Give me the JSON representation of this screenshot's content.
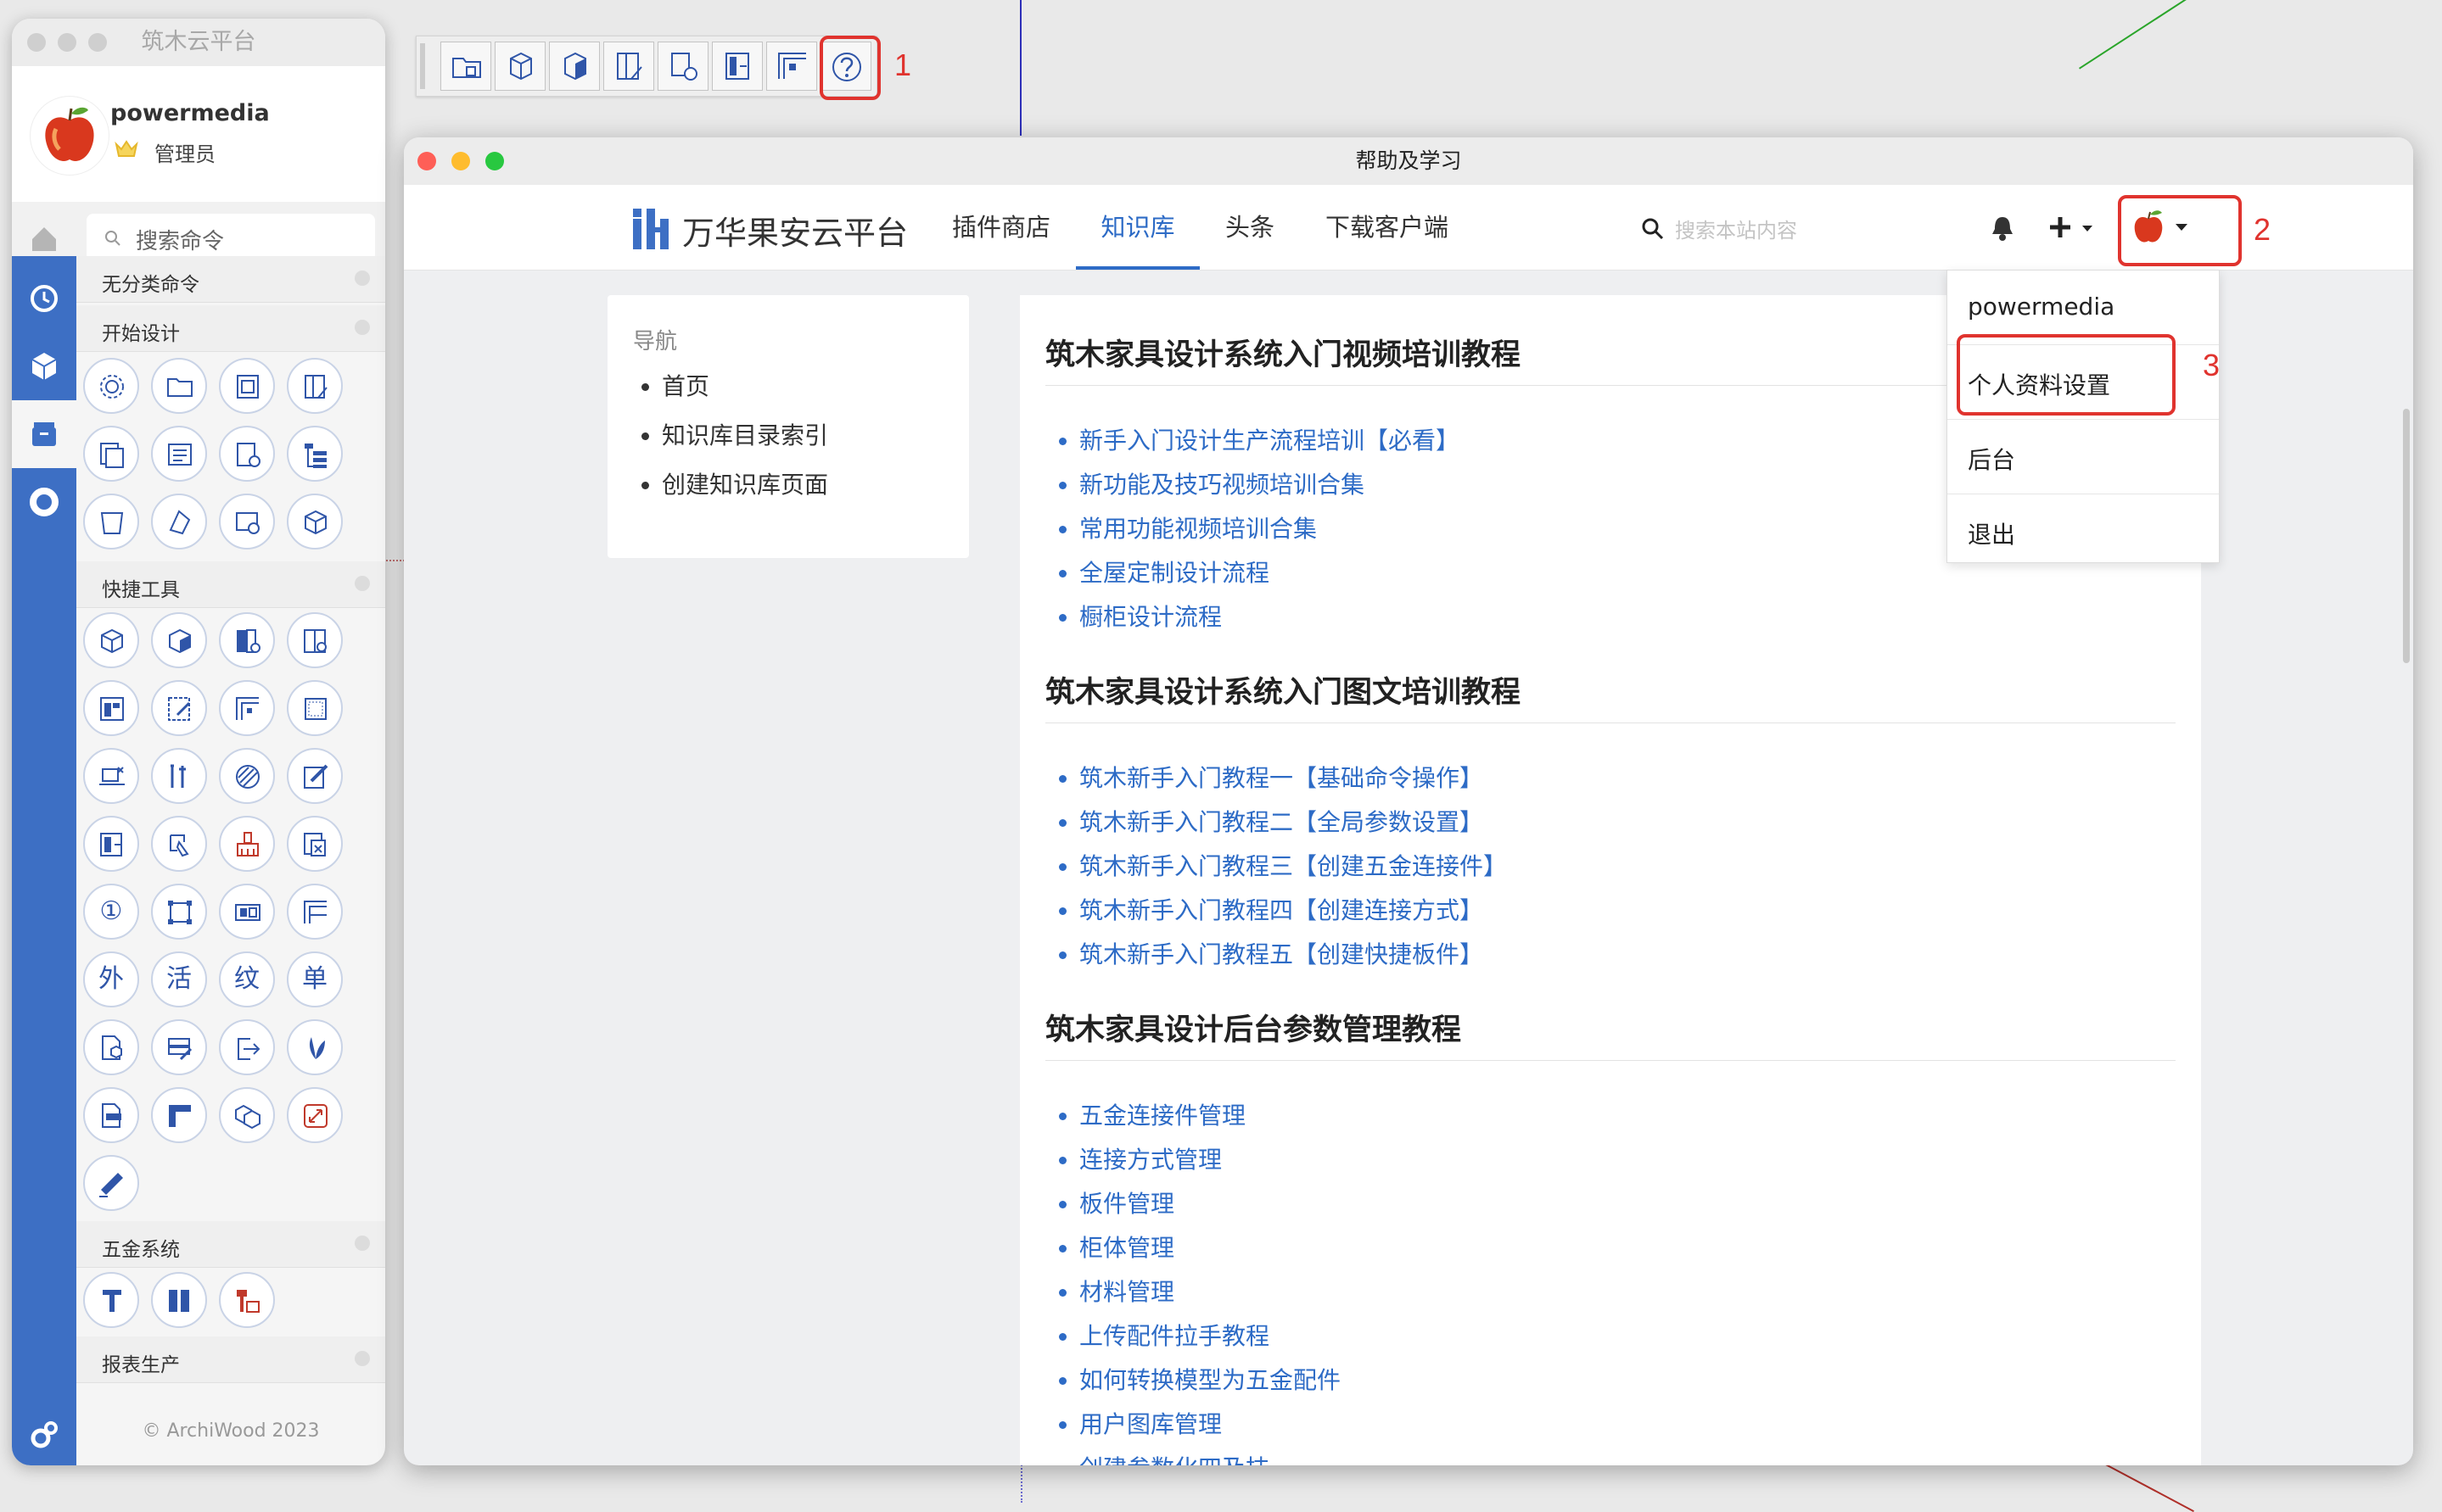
{
  "left_panel": {
    "title": "筑木云平台",
    "user_name": "powermedia",
    "user_role": "管理员",
    "search_placeholder": "搜索命令",
    "sections": [
      "无分类命令",
      "开始设计",
      "快捷工具",
      "五金系统",
      "报表生产"
    ],
    "text_tools": [
      "①",
      "外",
      "活",
      "纹",
      "单"
    ],
    "footer": "© ArchiWood 2023",
    "sidebar_icons": [
      "history-icon",
      "box-icon",
      "library-icon",
      "ring-icon",
      "settings-icon"
    ]
  },
  "toolbar": {
    "icons": [
      "folder-icon",
      "cube-icon",
      "cube-blue-icon",
      "panel-icon",
      "copy-icon",
      "door-icon",
      "corner-icon",
      "help-icon"
    ]
  },
  "annotations": [
    "1",
    "2",
    "3"
  ],
  "main_window": {
    "title": "帮助及学习",
    "brand": "万华果安云平台",
    "nav": [
      "插件商店",
      "知识库",
      "头条",
      "下载客户端"
    ],
    "active_nav": "知识库",
    "search_placeholder": "搜索本站内容",
    "sidebar_nav": {
      "heading": "导航",
      "items": [
        "首页",
        "知识库目录索引",
        "创建知识库页面"
      ]
    },
    "dropdown": [
      "powermedia",
      "个人资料设置",
      "后台",
      "退出"
    ],
    "sections": [
      {
        "title": "筑木家具设计系统入门视频培训教程",
        "links": [
          "新手入门设计生产流程培训【必看】",
          "新功能及技巧视频培训合集",
          "常用功能视频培训合集",
          "全屋定制设计流程",
          "橱柜设计流程"
        ]
      },
      {
        "title": "筑木家具设计系统入门图文培训教程",
        "links": [
          "筑木新手入门教程一【基础命令操作】",
          "筑木新手入门教程二【全局参数设置】",
          "筑木新手入门教程三【创建五金连接件】",
          "筑木新手入门教程四【创建连接方式】",
          "筑木新手入门教程五【创建快捷板件】"
        ]
      },
      {
        "title": "筑木家具设计后台参数管理教程",
        "links": [
          "五金连接件管理",
          "连接方式管理",
          "板件管理",
          "柜体管理",
          "材料管理",
          "上传配件拉手教程",
          "如何转换模型为五金配件",
          "用户图库管理",
          "创建参数化四及技"
        ]
      }
    ]
  }
}
